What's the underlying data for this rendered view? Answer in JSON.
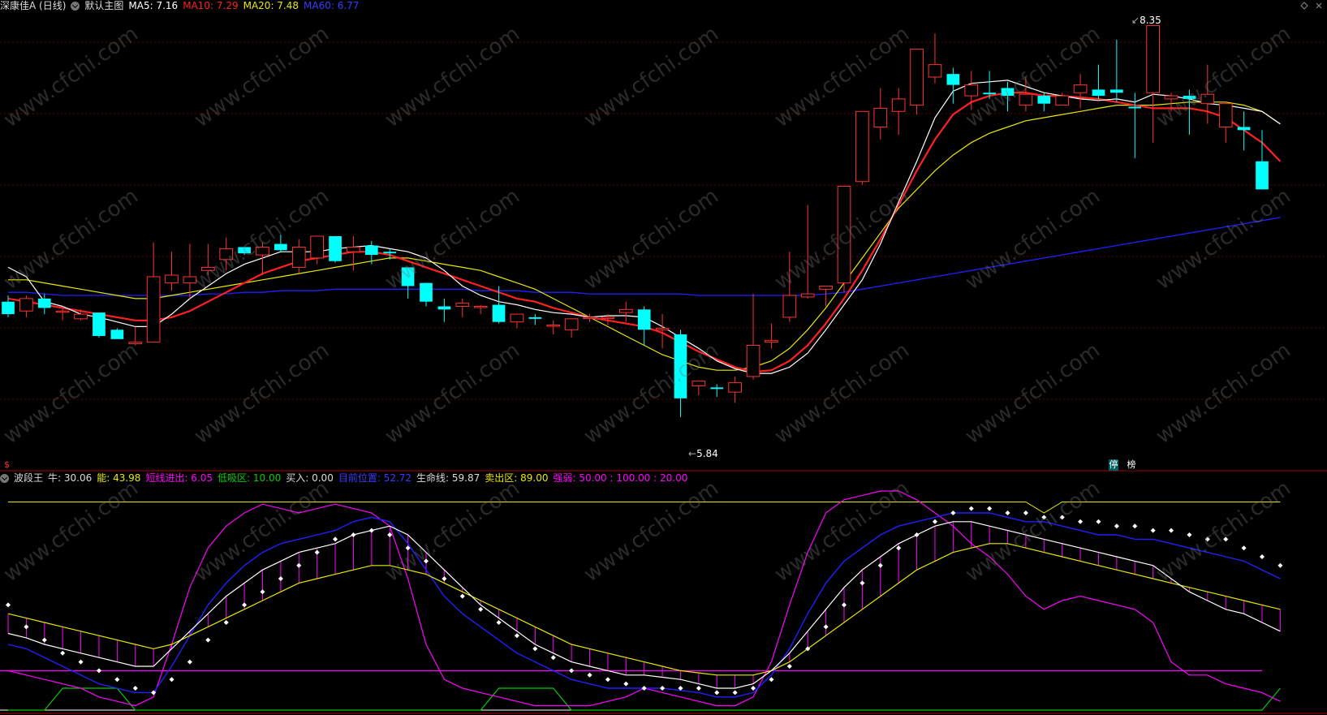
{
  "main_header": {
    "stock_name": "深康佳A (日线)",
    "template": "默认主图",
    "ma5": "MA5: 7.16",
    "ma10": "MA10: 7.29",
    "ma20": "MA20: 7.48",
    "ma60": "MA60: 6.77"
  },
  "indicator_header": {
    "name": "波段王",
    "niu": "牛: 30.06",
    "neng": "能: 43.98",
    "duanxian": "短线进出: 6.05",
    "dixiqu": "低吸区: 10.00",
    "mairu": "买入: 0.00",
    "dangqian": "目前位置: 52.72",
    "shengming": "生命线: 59.87",
    "maichu": "卖出区: 89.00",
    "qiangruo": "强弱: 50.00 : 100.00 : 20.00"
  },
  "annotations": {
    "high_price": "8.35",
    "low_price": "5.84",
    "badge_1": "停",
    "badge_2": "榜",
    "dollar": "$"
  },
  "watermark": "www.cfchi.com",
  "colors": {
    "up": "#ff3232",
    "down": "#00ffff",
    "ma5": "#ffffff",
    "ma10": "#ff2020",
    "ma20": "#e8e800",
    "ma60": "#2020ff",
    "magenta": "#ff00ff",
    "green": "#00c800",
    "grid": "#6a0000"
  },
  "chart_data": {
    "type": "candlestick",
    "ylim": [
      5.6,
      8.4
    ],
    "candles": [
      {
        "o": 6.58,
        "h": 6.62,
        "l": 6.48,
        "c": 6.5
      },
      {
        "o": 6.52,
        "h": 6.62,
        "l": 6.48,
        "c": 6.6
      },
      {
        "o": 6.6,
        "h": 6.63,
        "l": 6.5,
        "c": 6.54
      },
      {
        "o": 6.52,
        "h": 6.55,
        "l": 6.46,
        "c": 6.52
      },
      {
        "o": 6.47,
        "h": 6.53,
        "l": 6.46,
        "c": 6.5
      },
      {
        "o": 6.51,
        "h": 6.51,
        "l": 6.35,
        "c": 6.36
      },
      {
        "o": 6.4,
        "h": 6.41,
        "l": 6.34,
        "c": 6.34
      },
      {
        "o": 6.31,
        "h": 6.42,
        "l": 6.3,
        "c": 6.32
      },
      {
        "o": 6.32,
        "h": 6.96,
        "l": 6.32,
        "c": 6.74
      },
      {
        "o": 6.7,
        "h": 6.9,
        "l": 6.65,
        "c": 6.75
      },
      {
        "o": 6.7,
        "h": 6.95,
        "l": 6.6,
        "c": 6.74
      },
      {
        "o": 6.78,
        "h": 6.95,
        "l": 6.75,
        "c": 6.8
      },
      {
        "o": 6.85,
        "h": 6.99,
        "l": 6.78,
        "c": 6.92
      },
      {
        "o": 6.93,
        "h": 6.93,
        "l": 6.88,
        "c": 6.89
      },
      {
        "o": 6.88,
        "h": 6.96,
        "l": 6.75,
        "c": 6.93
      },
      {
        "o": 6.95,
        "h": 7.01,
        "l": 6.9,
        "c": 6.91
      },
      {
        "o": 6.8,
        "h": 6.98,
        "l": 6.76,
        "c": 6.93
      },
      {
        "o": 6.86,
        "h": 7.0,
        "l": 6.82,
        "c": 7.0
      },
      {
        "o": 7.0,
        "h": 7.0,
        "l": 6.83,
        "c": 6.84
      },
      {
        "o": 6.9,
        "h": 7.0,
        "l": 6.78,
        "c": 6.93
      },
      {
        "o": 6.94,
        "h": 6.97,
        "l": 6.82,
        "c": 6.88
      },
      {
        "o": 6.9,
        "h": 6.92,
        "l": 6.85,
        "c": 6.89
      },
      {
        "o": 6.8,
        "h": 6.8,
        "l": 6.6,
        "c": 6.68
      },
      {
        "o": 6.7,
        "h": 6.7,
        "l": 6.55,
        "c": 6.58
      },
      {
        "o": 6.55,
        "h": 6.6,
        "l": 6.45,
        "c": 6.53
      },
      {
        "o": 6.55,
        "h": 6.6,
        "l": 6.48,
        "c": 6.57
      },
      {
        "o": 6.55,
        "h": 6.56,
        "l": 6.5,
        "c": 6.55
      },
      {
        "o": 6.56,
        "h": 6.68,
        "l": 6.44,
        "c": 6.45
      },
      {
        "o": 6.45,
        "h": 6.5,
        "l": 6.41,
        "c": 6.5
      },
      {
        "o": 6.48,
        "h": 6.5,
        "l": 6.43,
        "c": 6.47
      },
      {
        "o": 6.43,
        "h": 6.46,
        "l": 6.37,
        "c": 6.43
      },
      {
        "o": 6.4,
        "h": 6.46,
        "l": 6.35,
        "c": 6.47
      },
      {
        "o": 6.48,
        "h": 6.5,
        "l": 6.45,
        "c": 6.48
      },
      {
        "o": 6.48,
        "h": 6.5,
        "l": 6.43,
        "c": 6.48
      },
      {
        "o": 6.51,
        "h": 6.58,
        "l": 6.45,
        "c": 6.53
      },
      {
        "o": 6.53,
        "h": 6.55,
        "l": 6.3,
        "c": 6.4
      },
      {
        "o": 6.4,
        "h": 6.5,
        "l": 6.28,
        "c": 6.41
      },
      {
        "o": 6.37,
        "h": 6.4,
        "l": 5.84,
        "c": 5.96
      },
      {
        "o": 6.04,
        "h": 6.05,
        "l": 5.98,
        "c": 6.07
      },
      {
        "o": 6.03,
        "h": 6.05,
        "l": 5.97,
        "c": 6.02
      },
      {
        "o": 6.0,
        "h": 6.1,
        "l": 5.93,
        "c": 6.06
      },
      {
        "o": 6.1,
        "h": 6.63,
        "l": 6.08,
        "c": 6.3
      },
      {
        "o": 6.32,
        "h": 6.44,
        "l": 6.28,
        "c": 6.33
      },
      {
        "o": 6.48,
        "h": 6.9,
        "l": 6.45,
        "c": 6.62
      },
      {
        "o": 6.61,
        "h": 7.2,
        "l": 6.6,
        "c": 6.63
      },
      {
        "o": 6.66,
        "h": 6.67,
        "l": 6.55,
        "c": 6.68
      },
      {
        "o": 6.7,
        "h": 7.3,
        "l": 6.64,
        "c": 7.32
      },
      {
        "o": 7.35,
        "h": 7.7,
        "l": 7.33,
        "c": 7.8
      },
      {
        "o": 7.7,
        "h": 7.95,
        "l": 7.62,
        "c": 7.82
      },
      {
        "o": 7.8,
        "h": 7.95,
        "l": 7.65,
        "c": 7.88
      },
      {
        "o": 7.84,
        "h": 8.1,
        "l": 7.78,
        "c": 8.2
      },
      {
        "o": 8.02,
        "h": 8.3,
        "l": 7.98,
        "c": 8.1
      },
      {
        "o": 8.04,
        "h": 8.08,
        "l": 7.85,
        "c": 7.97
      },
      {
        "o": 7.9,
        "h": 8.06,
        "l": 7.81,
        "c": 7.97
      },
      {
        "o": 7.92,
        "h": 8.06,
        "l": 7.88,
        "c": 7.91
      },
      {
        "o": 7.95,
        "h": 7.99,
        "l": 7.8,
        "c": 7.9
      },
      {
        "o": 7.84,
        "h": 8.02,
        "l": 7.8,
        "c": 7.91
      },
      {
        "o": 7.9,
        "h": 7.92,
        "l": 7.8,
        "c": 7.85
      },
      {
        "o": 7.84,
        "h": 7.92,
        "l": 7.84,
        "c": 7.9
      },
      {
        "o": 7.92,
        "h": 8.04,
        "l": 7.82,
        "c": 7.97
      },
      {
        "o": 7.94,
        "h": 8.1,
        "l": 7.88,
        "c": 7.9
      },
      {
        "o": 7.94,
        "h": 8.26,
        "l": 7.86,
        "c": 7.92
      },
      {
        "o": 7.83,
        "h": 7.92,
        "l": 7.5,
        "c": 7.82
      },
      {
        "o": 7.92,
        "h": 8.35,
        "l": 7.6,
        "c": 8.35
      },
      {
        "o": 7.88,
        "h": 7.92,
        "l": 7.8,
        "c": 7.9
      },
      {
        "o": 7.9,
        "h": 7.94,
        "l": 7.65,
        "c": 7.88
      },
      {
        "o": 7.85,
        "h": 8.1,
        "l": 7.72,
        "c": 7.91
      },
      {
        "o": 7.7,
        "h": 7.8,
        "l": 7.6,
        "c": 7.85
      },
      {
        "o": 7.7,
        "h": 7.8,
        "l": 7.55,
        "c": 7.68
      },
      {
        "o": 7.48,
        "h": 7.68,
        "l": 7.4,
        "c": 7.3
      }
    ],
    "ma5": [
      6.8,
      6.74,
      6.58,
      6.55,
      6.5,
      6.48,
      6.45,
      6.42,
      6.42,
      6.5,
      6.6,
      6.68,
      6.76,
      6.82,
      6.86,
      6.9,
      6.9,
      6.9,
      6.92,
      6.93,
      6.94,
      6.92,
      6.9,
      6.86,
      6.78,
      6.68,
      6.62,
      6.58,
      6.56,
      6.53,
      6.51,
      6.5,
      6.48,
      6.49,
      6.49,
      6.48,
      6.42,
      6.35,
      6.28,
      6.2,
      6.15,
      6.12,
      6.12,
      6.16,
      6.25,
      6.4,
      6.56,
      6.72,
      6.95,
      7.22,
      7.48,
      7.76,
      7.93,
      7.98,
      7.99,
      8.0,
      7.96,
      7.92,
      7.9,
      7.88,
      7.87,
      7.88,
      7.86,
      7.91,
      7.9,
      7.88,
      7.85,
      7.84,
      7.82,
      7.8,
      7.72
    ],
    "ma10": [
      6.6,
      6.58,
      6.56,
      6.54,
      6.52,
      6.5,
      6.48,
      6.46,
      6.46,
      6.48,
      6.52,
      6.58,
      6.64,
      6.7,
      6.76,
      6.8,
      6.84,
      6.86,
      6.88,
      6.9,
      6.9,
      6.88,
      6.84,
      6.8,
      6.76,
      6.72,
      6.68,
      6.64,
      6.6,
      6.58,
      6.54,
      6.51,
      6.48,
      6.46,
      6.44,
      6.42,
      6.38,
      6.32,
      6.26,
      6.21,
      6.16,
      6.13,
      6.14,
      6.2,
      6.3,
      6.44,
      6.6,
      6.78,
      6.98,
      7.2,
      7.42,
      7.62,
      7.78,
      7.86,
      7.9,
      7.92,
      7.92,
      7.9,
      7.9,
      7.89,
      7.88,
      7.86,
      7.84,
      7.82,
      7.82,
      7.82,
      7.8,
      7.76,
      7.68,
      7.6,
      7.48
    ],
    "ma20": [
      6.72,
      6.72,
      6.7,
      6.68,
      6.66,
      6.64,
      6.62,
      6.6,
      6.6,
      6.62,
      6.64,
      6.66,
      6.68,
      6.7,
      6.72,
      6.74,
      6.76,
      6.78,
      6.8,
      6.82,
      6.84,
      6.86,
      6.86,
      6.84,
      6.82,
      6.8,
      6.78,
      6.74,
      6.7,
      6.66,
      6.6,
      6.54,
      6.48,
      6.42,
      6.36,
      6.3,
      6.24,
      6.2,
      6.16,
      6.14,
      6.14,
      6.16,
      6.2,
      6.28,
      6.4,
      6.54,
      6.7,
      6.86,
      7.02,
      7.18,
      7.3,
      7.42,
      7.52,
      7.6,
      7.66,
      7.7,
      7.74,
      7.76,
      7.78,
      7.8,
      7.82,
      7.84,
      7.84,
      7.84,
      7.85,
      7.86,
      7.86,
      7.86,
      7.84,
      7.8,
      7.72
    ],
    "ma60": [
      6.64,
      6.64,
      6.63,
      6.62,
      6.62,
      6.62,
      6.62,
      6.62,
      6.62,
      6.62,
      6.62,
      6.63,
      6.63,
      6.64,
      6.64,
      6.65,
      6.65,
      6.65,
      6.66,
      6.66,
      6.66,
      6.66,
      6.66,
      6.66,
      6.66,
      6.66,
      6.65,
      6.65,
      6.65,
      6.64,
      6.64,
      6.64,
      6.63,
      6.63,
      6.63,
      6.63,
      6.63,
      6.63,
      6.62,
      6.62,
      6.62,
      6.62,
      6.62,
      6.62,
      6.62,
      6.63,
      6.64,
      6.66,
      6.68,
      6.7,
      6.72,
      6.74,
      6.76,
      6.78,
      6.8,
      6.82,
      6.84,
      6.86,
      6.88,
      6.9,
      6.92,
      6.94,
      6.96,
      6.98,
      7.0,
      7.02,
      7.04,
      7.06,
      7.08,
      7.1,
      7.12
    ],
    "indicator": {
      "ylim": [
        0,
        100
      ],
      "white": [
        35,
        33,
        30,
        28,
        26,
        24,
        22,
        20,
        20,
        28,
        36,
        44,
        52,
        58,
        64,
        68,
        72,
        74,
        76,
        80,
        82,
        84,
        80,
        72,
        64,
        56,
        48,
        42,
        36,
        30,
        26,
        22,
        20,
        18,
        16,
        16,
        15,
        14,
        12,
        10,
        10,
        12,
        18,
        26,
        36,
        46,
        56,
        64,
        70,
        76,
        80,
        84,
        86,
        86,
        84,
        82,
        80,
        78,
        76,
        74,
        72,
        70,
        68,
        66,
        60,
        54,
        50,
        46,
        44,
        40,
        36
      ],
      "yellow": [
        44,
        42,
        40,
        38,
        36,
        34,
        32,
        30,
        28,
        30,
        34,
        38,
        42,
        46,
        50,
        54,
        58,
        60,
        62,
        64,
        66,
        66,
        64,
        62,
        58,
        54,
        50,
        46,
        42,
        38,
        34,
        30,
        28,
        26,
        24,
        22,
        20,
        18,
        17,
        16,
        16,
        16,
        18,
        22,
        28,
        34,
        40,
        46,
        52,
        58,
        64,
        68,
        72,
        74,
        76,
        76,
        74,
        72,
        70,
        68,
        66,
        64,
        62,
        60,
        58,
        56,
        54,
        52,
        50,
        48,
        46
      ],
      "blue": [
        30,
        28,
        24,
        20,
        16,
        12,
        10,
        8,
        8,
        20,
        34,
        48,
        58,
        66,
        72,
        76,
        78,
        80,
        82,
        86,
        88,
        86,
        76,
        64,
        52,
        44,
        38,
        32,
        26,
        22,
        18,
        14,
        12,
        10,
        10,
        10,
        10,
        9,
        8,
        6,
        6,
        8,
        16,
        28,
        44,
        58,
        68,
        74,
        80,
        84,
        86,
        88,
        90,
        90,
        90,
        88,
        86,
        86,
        84,
        82,
        80,
        80,
        78,
        78,
        76,
        74,
        72,
        70,
        68,
        64,
        60
      ],
      "magenta": [
        18,
        16,
        14,
        12,
        10,
        6,
        4,
        2,
        6,
        30,
        56,
        74,
        84,
        90,
        94,
        92,
        90,
        92,
        94,
        92,
        90,
        84,
        60,
        30,
        14,
        10,
        8,
        6,
        4,
        2,
        2,
        2,
        2,
        4,
        6,
        10,
        8,
        6,
        4,
        2,
        2,
        6,
        22,
        48,
        72,
        90,
        96,
        98,
        100,
        100,
        96,
        90,
        84,
        76,
        70,
        62,
        52,
        46,
        50,
        52,
        50,
        48,
        46,
        40,
        22,
        16,
        16,
        12,
        10,
        8,
        4
      ],
      "green": [
        0,
        0,
        0,
        10,
        10,
        10,
        10,
        0,
        0,
        0,
        0,
        0,
        0,
        0,
        0,
        0,
        0,
        0,
        0,
        0,
        0,
        0,
        0,
        0,
        0,
        0,
        0,
        10,
        10,
        10,
        10,
        0,
        0,
        0,
        0,
        0,
        0,
        0,
        0,
        0,
        0,
        0,
        0,
        0,
        0,
        0,
        0,
        0,
        0,
        0,
        0,
        0,
        0,
        0,
        0,
        0,
        0,
        0,
        0,
        0,
        0,
        0,
        0,
        0,
        0,
        0,
        0,
        0,
        0,
        0,
        10
      ],
      "dots": [
        48,
        38,
        32,
        26,
        22,
        18,
        14,
        10,
        8,
        14,
        22,
        32,
        40,
        48,
        54,
        60,
        66,
        72,
        78,
        80,
        82,
        80,
        74,
        68,
        60,
        52,
        46,
        40,
        34,
        28,
        24,
        18,
        16,
        14,
        12,
        10,
        10,
        10,
        10,
        8,
        8,
        10,
        14,
        20,
        28,
        38,
        48,
        58,
        66,
        74,
        80,
        86,
        90,
        92,
        92,
        90,
        90,
        88,
        88,
        86,
        86,
        84,
        84,
        82,
        82,
        80,
        78,
        78,
        74,
        70,
        66
      ],
      "yellow_top": [
        95,
        95,
        95,
        95,
        95,
        95,
        95,
        95,
        95,
        95,
        95,
        95,
        95,
        95,
        95,
        95,
        95,
        95,
        95,
        95,
        95,
        95,
        95,
        95,
        95,
        95,
        95,
        95,
        95,
        95,
        95,
        95,
        95,
        95,
        95,
        95,
        95,
        95,
        95,
        95,
        95,
        95,
        95,
        95,
        95,
        95,
        95,
        95,
        95,
        95,
        95,
        95,
        95,
        95,
        95,
        95,
        95,
        90,
        95,
        95,
        95,
        95,
        95,
        95,
        95,
        95,
        95,
        95,
        95,
        95,
        95
      ],
      "level_mag": 18
    }
  }
}
